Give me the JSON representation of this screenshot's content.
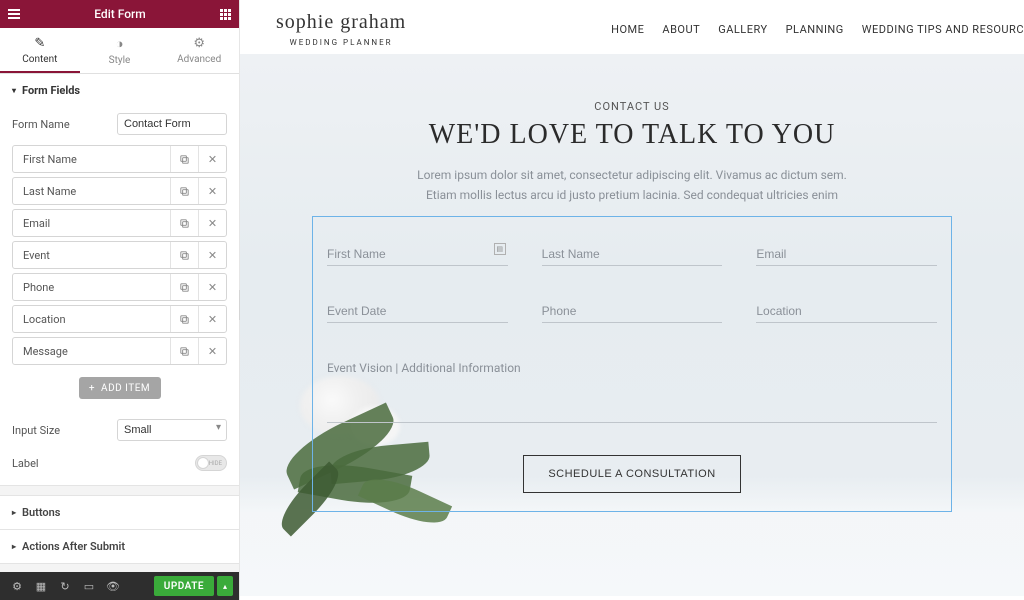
{
  "panel": {
    "title": "Edit Form",
    "tabs": {
      "content": "Content",
      "style": "Style",
      "advanced": "Advanced"
    },
    "section_form_fields": "Form Fields",
    "form_name_label": "Form Name",
    "form_name_value": "Contact Form",
    "fields": [
      {
        "label": "First Name"
      },
      {
        "label": "Last Name"
      },
      {
        "label": "Email"
      },
      {
        "label": "Event"
      },
      {
        "label": "Phone"
      },
      {
        "label": "Location"
      },
      {
        "label": "Message"
      }
    ],
    "add_item": "ADD ITEM",
    "input_size_label": "Input Size",
    "input_size_value": "Small",
    "label_label": "Label",
    "label_toggle_text": "HIDE",
    "accordion": {
      "buttons": "Buttons",
      "actions": "Actions After Submit"
    },
    "update": "UPDATE"
  },
  "site": {
    "brand_name": "sophie graham",
    "brand_sub": "WEDDING PLANNER",
    "nav": [
      "HOME",
      "ABOUT",
      "GALLERY",
      "PLANNING",
      "WEDDING TIPS AND RESOURC"
    ],
    "contact_eyebrow": "CONTACT US",
    "contact_heading": "WE'D LOVE TO TALK TO YOU",
    "contact_desc_1": "Lorem ipsum dolor sit amet, consectetur adipiscing elit. Vivamus ac dictum sem.",
    "contact_desc_2": "Etiam mollis lectus arcu id justo pretium lacinia. Sed condequat ultricies enim",
    "placeholders": {
      "first_name": "First Name",
      "last_name": "Last Name",
      "email": "Email",
      "event_date": "Event Date",
      "phone": "Phone",
      "location": "Location",
      "message": "Event Vision | Additional Information"
    },
    "button": "SCHEDULE A CONSULTATION"
  }
}
